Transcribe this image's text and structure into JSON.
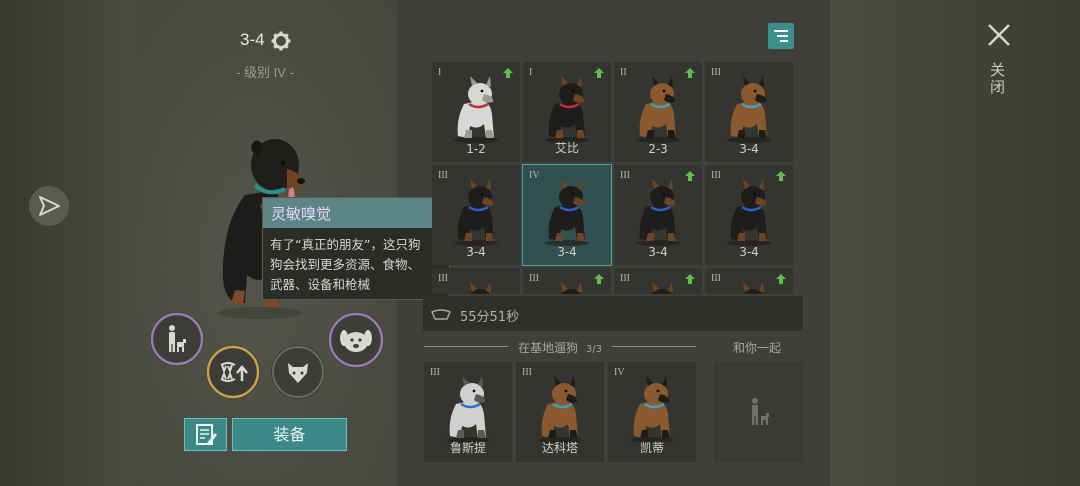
{
  "dog": {
    "title": "3-4",
    "level": "- 级别 IV -"
  },
  "close": {
    "label": "关闭"
  },
  "tooltip": {
    "title": "灵敏嗅觉",
    "lines": [
      "有了“真正的朋友”，这只狗",
      "狗会找到更多资源、食物、",
      "武器、设备和枪械"
    ]
  },
  "grid": {
    "cards": [
      {
        "tier": "I",
        "name": "1-2",
        "upgrade": true,
        "breed": "husky-pup"
      },
      {
        "tier": "I",
        "name": "艾比",
        "upgrade": true,
        "breed": "rottweiler-pup"
      },
      {
        "tier": "II",
        "name": "2-3",
        "upgrade": true,
        "breed": "shepherd"
      },
      {
        "tier": "III",
        "name": "3-4",
        "upgrade": false,
        "breed": "shepherd"
      },
      {
        "tier": "III",
        "name": "3-4",
        "upgrade": false,
        "breed": "rottweiler"
      },
      {
        "tier": "IV",
        "name": "3-4",
        "upgrade": false,
        "breed": "rottweiler",
        "selected": true
      },
      {
        "tier": "III",
        "name": "3-4",
        "upgrade": true,
        "breed": "rottweiler"
      },
      {
        "tier": "III",
        "name": "3-4",
        "upgrade": true,
        "breed": "rottweiler"
      },
      {
        "tier": "III",
        "name": "",
        "upgrade": false,
        "breed": "rottweiler"
      },
      {
        "tier": "III",
        "name": "",
        "upgrade": true,
        "breed": "rottweiler"
      },
      {
        "tier": "III",
        "name": "",
        "upgrade": true,
        "breed": "rottweiler"
      },
      {
        "tier": "III",
        "name": "",
        "upgrade": true,
        "breed": "rottweiler"
      }
    ]
  },
  "timer": {
    "text": "55分51秒"
  },
  "roaming": {
    "label": "在基地遛狗",
    "count": "3/3",
    "dogs": [
      {
        "tier": "III",
        "name": "鲁斯提",
        "breed": "husky"
      },
      {
        "tier": "III",
        "name": "达科塔",
        "breed": "shepherd"
      },
      {
        "tier": "IV",
        "name": "凯蒂",
        "breed": "shepherd"
      }
    ]
  },
  "with_you": {
    "label": "和你一起"
  },
  "buttons": {
    "equip": "装备"
  },
  "colors": {
    "accent": "#3c8a88",
    "upgrade_arrow": "#5fbf4a",
    "tooltip_title": "#e6d6f5"
  }
}
